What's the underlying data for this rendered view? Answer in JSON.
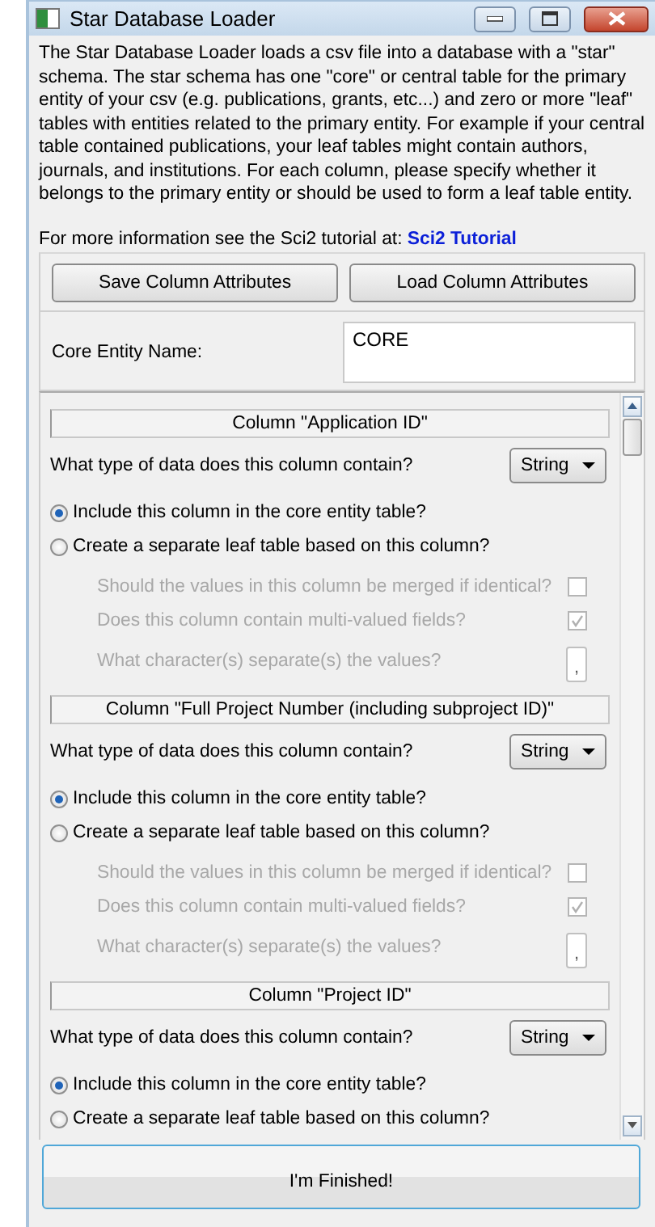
{
  "window": {
    "title": "Star Database Loader"
  },
  "description": "The Star Database Loader loads a csv file into a database with a \"star\" schema. The star schema has one \"core\" or central table for the primary entity of your csv (e.g. publications, grants, etc...) and zero or more \"leaf\" tables with entities related to the primary entity. For example if your central table contained publications, your leaf tables might contain authors, journals, and institutions. For each column, please specify whether it belongs to the primary entity or should be used to form a leaf table entity.",
  "tutorial": {
    "text": "For more information see the Sci2 tutorial at:",
    "link": "Sci2 Tutorial"
  },
  "buttons": [
    "Save Column Attributes",
    "Load Column Attributes"
  ],
  "core_entity": {
    "label": "Core Entity Name:",
    "value": "CORE"
  },
  "columns": [
    {
      "title": "Column \"Application ID\"",
      "type_question": "What type of data does this column contain?",
      "type_value": "String",
      "options": [
        {
          "label": "Include this column in the core entity table?",
          "selected": true
        },
        {
          "label": "Create a separate leaf table based on this column?",
          "selected": false
        }
      ],
      "leaf_settings": {
        "merge": {
          "label": "Should the values in this column be merged if identical?",
          "checked": false,
          "disabled": true
        },
        "multi_valued": {
          "label": "Does this column contain multi-valued fields?",
          "checked": true,
          "disabled": true
        },
        "separator": {
          "label": "What character(s) separate(s) the values?",
          "value": ",",
          "disabled": true
        }
      }
    },
    {
      "title": "Column \"Full Project Number (including subproject ID)\"",
      "type_question": "What type of data does this column contain?",
      "type_value": "String",
      "options": [
        {
          "label": "Include this column in the core entity table?",
          "selected": true
        },
        {
          "label": "Create a separate leaf table based on this column?",
          "selected": false
        }
      ],
      "leaf_settings": {
        "merge": {
          "label": "Should the values in this column be merged if identical?",
          "checked": false,
          "disabled": true
        },
        "multi_valued": {
          "label": "Does this column contain multi-valued fields?",
          "checked": true,
          "disabled": true
        },
        "separator": {
          "label": "What character(s) separate(s) the values?",
          "value": ",",
          "disabled": true
        }
      }
    },
    {
      "title": "Column \"Project ID\"",
      "type_question": "What type of data does this column contain?",
      "type_value": "String",
      "options": [
        {
          "label": "Include this column in the core entity table?",
          "selected": true
        },
        {
          "label": "Create a separate leaf table based on this column?",
          "selected": false
        }
      ]
    }
  ],
  "finish_button": "I'm Finished!"
}
